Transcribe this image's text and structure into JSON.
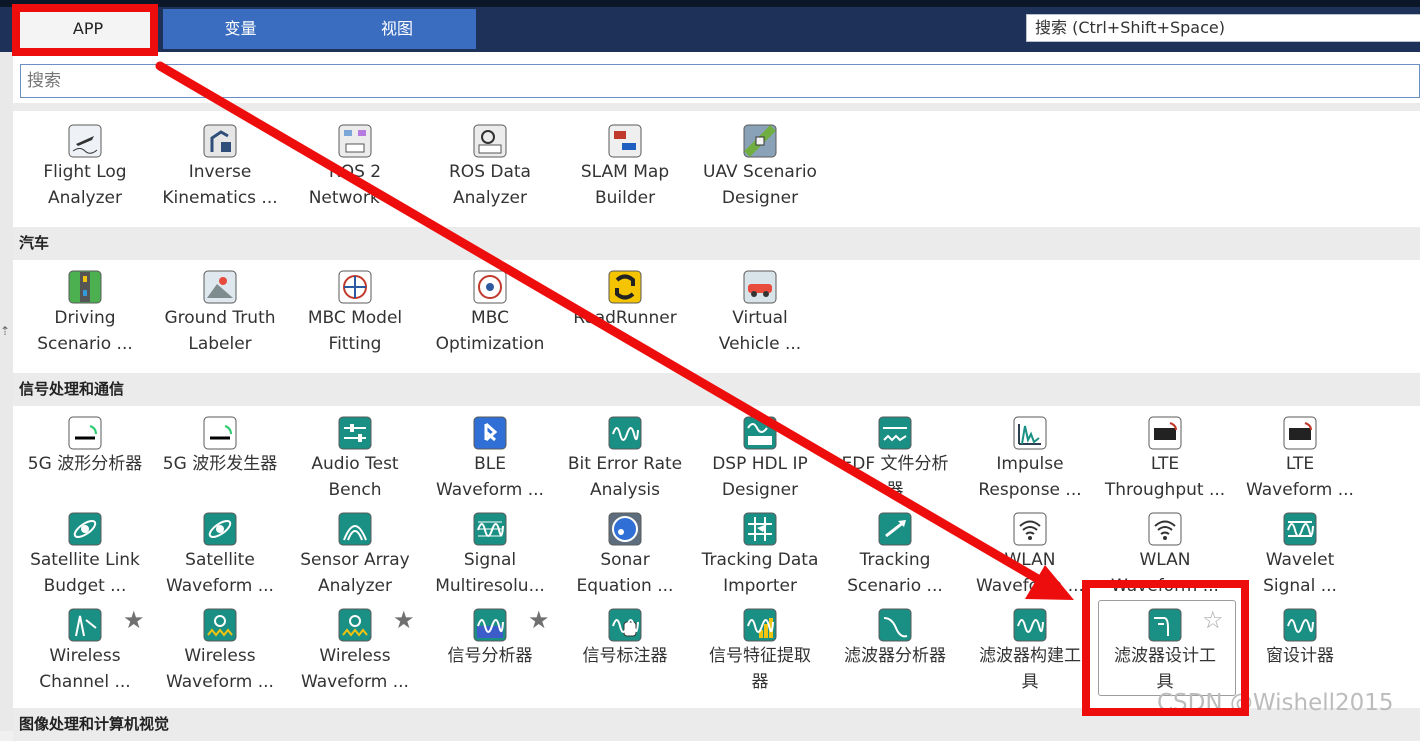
{
  "ribbon": {
    "tabs": [
      "APP",
      "变量",
      "视图"
    ],
    "help_search_placeholder": "搜索 (Ctrl+Shift+Space)"
  },
  "gallery": {
    "search_placeholder": "搜索",
    "categories": [
      "汽车",
      "信号处理和通信",
      "图像处理和计算机视觉"
    ],
    "rows": {
      "robotics": [
        {
          "line1": "Flight Log",
          "line2": "Analyzer",
          "icon": "flight-log-icon"
        },
        {
          "line1": "Inverse",
          "line2": "Kinematics ...",
          "icon": "inverse-kinematics-icon"
        },
        {
          "line1": "ROS 2",
          "line2": "Network ...",
          "icon": "ros-network-icon"
        },
        {
          "line1": "ROS Data",
          "line2": "Analyzer",
          "icon": "ros-data-icon"
        },
        {
          "line1": "SLAM Map",
          "line2": "Builder",
          "icon": "slam-map-icon"
        },
        {
          "line1": "UAV Scenario",
          "line2": "Designer",
          "icon": "uav-scenario-icon"
        }
      ],
      "automotive": [
        {
          "line1": "Driving",
          "line2": "Scenario ...",
          "icon": "driving-scenario-icon"
        },
        {
          "line1": "Ground Truth",
          "line2": "Labeler",
          "icon": "ground-truth-icon"
        },
        {
          "line1": "MBC Model",
          "line2": "Fitting",
          "icon": "mbc-model-icon"
        },
        {
          "line1": "MBC",
          "line2": "Optimization",
          "icon": "mbc-optimization-icon"
        },
        {
          "line1": "RoadRunner",
          "line2": "",
          "icon": "roadrunner-icon"
        },
        {
          "line1": "Virtual",
          "line2": "Vehicle ...",
          "icon": "virtual-vehicle-icon"
        }
      ],
      "signal1": [
        {
          "line1": "5G 波形分析器",
          "line2": "",
          "icon": "5g-analyzer-icon"
        },
        {
          "line1": "5G 波形发生器",
          "line2": "",
          "icon": "5g-generator-icon"
        },
        {
          "line1": "Audio Test",
          "line2": "Bench",
          "icon": "audio-test-icon"
        },
        {
          "line1": "BLE",
          "line2": "Waveform ...",
          "icon": "ble-icon"
        },
        {
          "line1": "Bit Error Rate",
          "line2": "Analysis",
          "icon": "ber-icon"
        },
        {
          "line1": "DSP HDL IP",
          "line2": "Designer",
          "icon": "dsp-hdl-icon"
        },
        {
          "line1": "EDF 文件分析",
          "line2": "器",
          "icon": "edf-icon"
        },
        {
          "line1": "Impulse",
          "line2": "Response ...",
          "icon": "impulse-response-icon"
        },
        {
          "line1": "LTE",
          "line2": "Throughput ...",
          "icon": "lte-throughput-icon"
        },
        {
          "line1": "LTE",
          "line2": "Waveform ...",
          "icon": "lte-waveform-icon"
        }
      ],
      "signal2": [
        {
          "line1": "Satellite Link",
          "line2": "Budget ...",
          "icon": "satellite-link-icon"
        },
        {
          "line1": "Satellite",
          "line2": "Waveform ...",
          "icon": "satellite-waveform-icon"
        },
        {
          "line1": "Sensor Array",
          "line2": "Analyzer",
          "icon": "sensor-array-icon"
        },
        {
          "line1": "Signal",
          "line2": "Multiresolu...",
          "icon": "signal-multires-icon"
        },
        {
          "line1": "Sonar",
          "line2": "Equation ...",
          "icon": "sonar-icon"
        },
        {
          "line1": "Tracking Data",
          "line2": "Importer",
          "icon": "tracking-data-icon"
        },
        {
          "line1": "Tracking",
          "line2": "Scenario ...",
          "icon": "tracking-scenario-icon"
        },
        {
          "line1": "WLAN",
          "line2": "Waveform ...",
          "icon": "wlan-icon"
        },
        {
          "line1": "WLAN",
          "line2": "Waveform ...",
          "icon": "wlan-icon"
        },
        {
          "line1": "Wavelet",
          "line2": "Signal ...",
          "icon": "wavelet-icon"
        }
      ],
      "signal3": [
        {
          "line1": "Wireless",
          "line2": "Channel ...",
          "icon": "wireless-channel-icon"
        },
        {
          "line1": "Wireless",
          "line2": "Waveform ...",
          "icon": "wireless-waveform-icon"
        },
        {
          "line1": "Wireless",
          "line2": "Waveform ...",
          "icon": "wireless-waveform-icon"
        },
        {
          "line1": "信号分析器",
          "line2": "",
          "icon": "signal-analyzer-icon"
        },
        {
          "line1": "信号标注器",
          "line2": "",
          "icon": "signal-labeler-icon"
        },
        {
          "line1": "信号特征提取",
          "line2": "器",
          "icon": "feature-extract-icon"
        },
        {
          "line1": "滤波器分析器",
          "line2": "",
          "icon": "filter-analyzer-icon"
        },
        {
          "line1": "滤波器构建工",
          "line2": "具",
          "icon": "filter-builder-icon"
        },
        {
          "line1": "滤波器设计工",
          "line2": "具",
          "icon": "filter-designer-icon"
        },
        {
          "line1": "窗设计器",
          "line2": "",
          "icon": "window-designer-icon"
        }
      ]
    }
  },
  "watermark": "CSDN @Wishell2015",
  "colors": {
    "ribbon": "#1e3158",
    "tab_blue": "#3a6cbf",
    "annotation_red": "#ee0d0d",
    "app_teal": "#1a8f84"
  }
}
